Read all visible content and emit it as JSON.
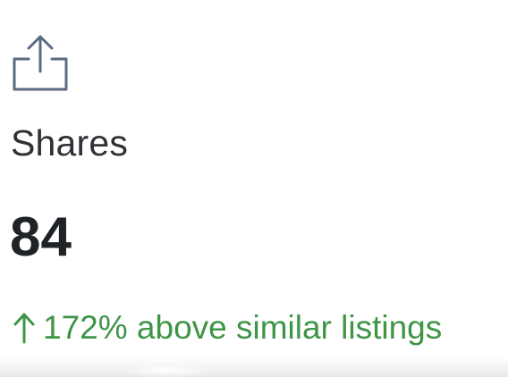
{
  "metric": {
    "icon": "share-icon",
    "label": "Shares",
    "value": "84",
    "comparison": {
      "icon": "arrow-up-icon",
      "text": "172% above similar listings",
      "color": "#3e9546"
    }
  }
}
